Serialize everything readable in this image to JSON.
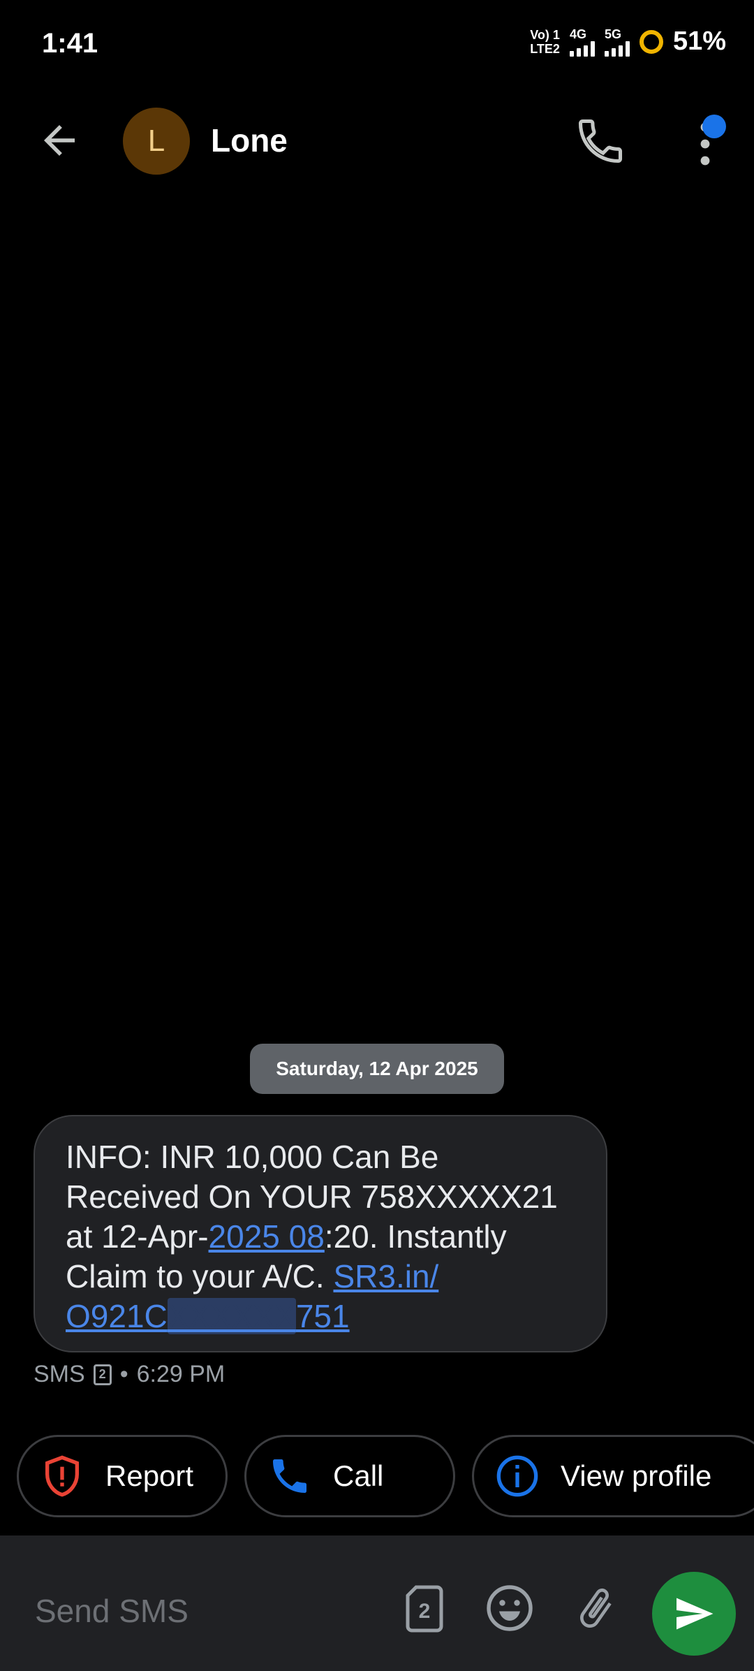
{
  "status_bar": {
    "time": "1:41",
    "net1": "Vo) 1",
    "net2": "LTE2",
    "net_4g": "4G",
    "net_5g": "5G",
    "battery": "51%"
  },
  "header": {
    "avatar_letter": "L",
    "contact_name": "Lone",
    "icons": [
      "back-arrow-icon",
      "phone-icon",
      "more-vert-icon"
    ]
  },
  "conversation": {
    "date_chip": "Saturday, 12 Apr 2025",
    "message": {
      "part1": "INFO: INR 10,000 Can Be Received On YOUR 758XXXXX21 at 12-Apr-",
      "link1": "2025 08",
      "part2": ":20. Instantly Claim to your A/C. ",
      "link2a": "SR3.in/",
      "link2b_start": "O921C",
      "link2b_end": "751"
    },
    "meta": {
      "type": "SMS",
      "sim": "2",
      "separator": "•",
      "time": "6:29 PM"
    }
  },
  "actions": {
    "report": "Report",
    "call": "Call",
    "view_profile": "View profile"
  },
  "compose": {
    "placeholder": "Send SMS",
    "sim": "2"
  },
  "colors": {
    "accent_blue": "#1a73e8",
    "send_green": "#1e8e3e",
    "report_red": "#ea4335",
    "link_blue": "#4a86e8"
  }
}
